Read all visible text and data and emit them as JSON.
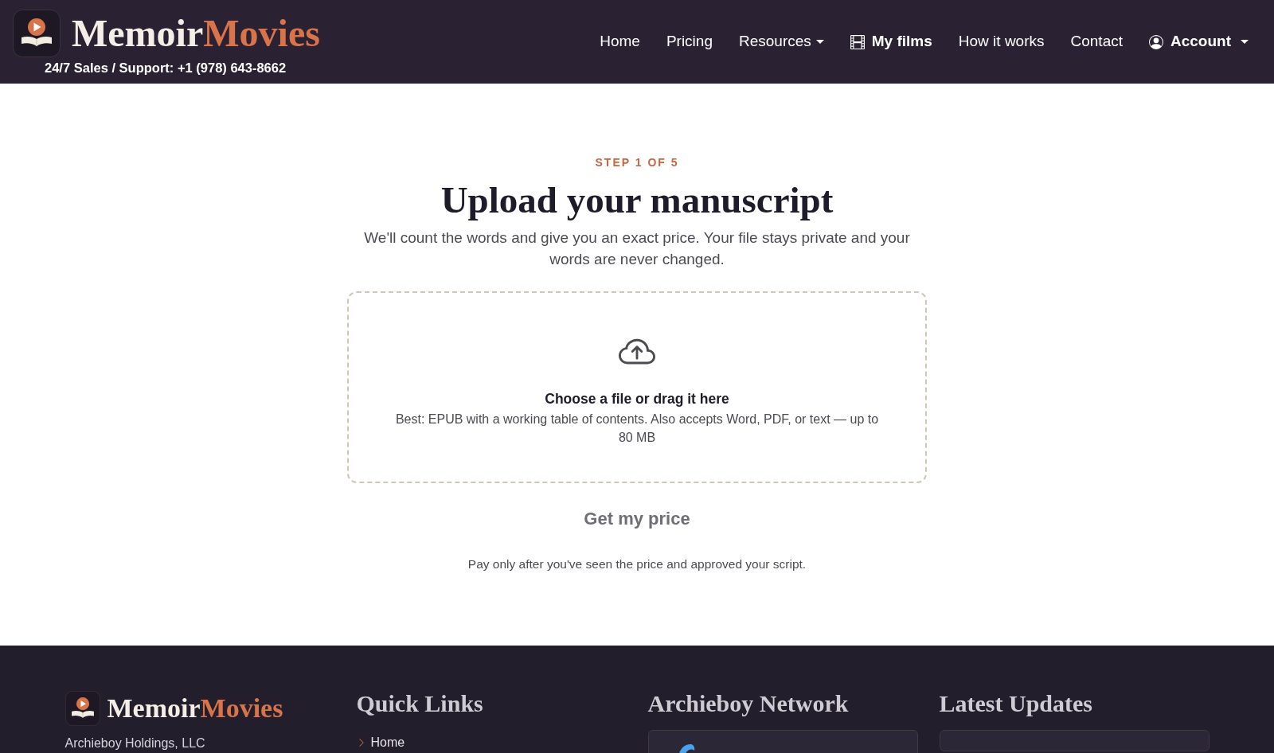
{
  "header": {
    "brand": {
      "first_word": "Memoir",
      "second_word": "Movies"
    },
    "support": "24/7 Sales / Support: +1 (978) 643-8662",
    "nav": [
      {
        "label": "Home",
        "kind": "link"
      },
      {
        "label": "Pricing",
        "kind": "link"
      },
      {
        "label": "Resources",
        "kind": "menu"
      },
      {
        "label": "My films",
        "kind": "films"
      },
      {
        "label": "How it works",
        "kind": "link"
      },
      {
        "label": "Contact",
        "kind": "link"
      },
      {
        "label": "Account",
        "kind": "account"
      }
    ]
  },
  "upload_step": {
    "step": "STEP 1 OF 5",
    "title": "Upload your manuscript",
    "intro": "We'll count the words and give you an exact price. Your file stays private and your words are never changed.",
    "dropzone": {
      "heading": "Choose a file or drag it here",
      "hint": "Best: EPUB with a working table of contents. Also accepts Word, PDF, or text — up to 80 MB"
    },
    "submit": {
      "label": "Get my price",
      "disabled": true
    },
    "note": "Pay only after you've seen the price and approved your script."
  },
  "footer": {
    "brand": {
      "first_word": "Memoir",
      "second_word": "Movies"
    },
    "company": "Archieboy Holdings, LLC",
    "quick_links": {
      "heading": "Quick Links",
      "links": [
        {
          "label": "Home"
        }
      ]
    },
    "network": {
      "heading": "Archieboy Network"
    },
    "updates": {
      "heading": "Latest Updates"
    }
  }
}
